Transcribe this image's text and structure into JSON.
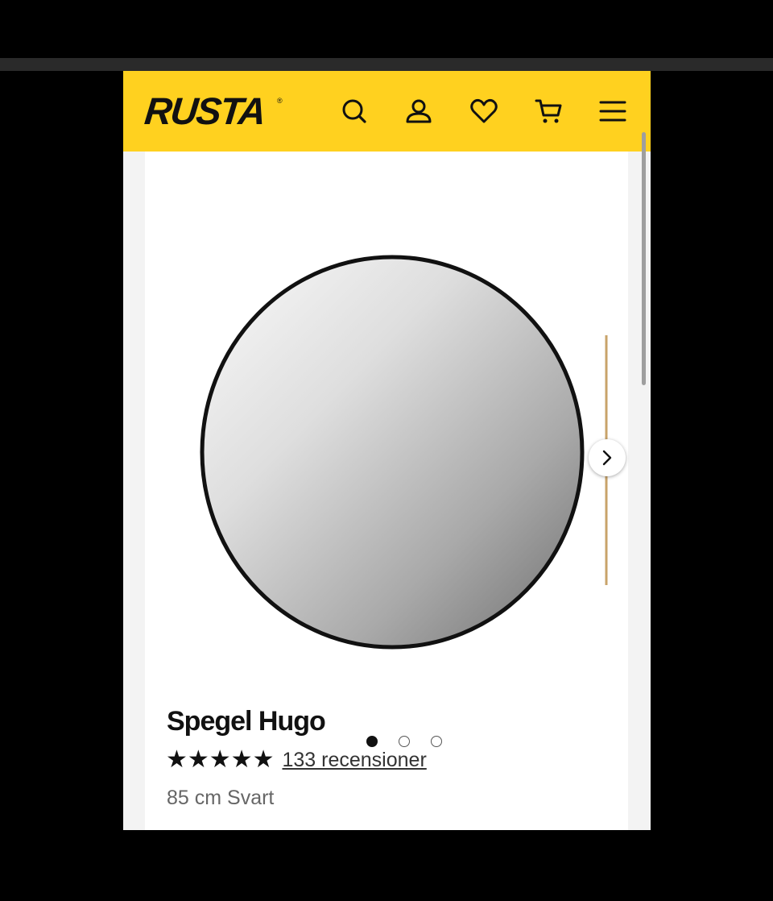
{
  "header": {
    "logo": "RUSTA",
    "background": "#ffd11f",
    "icons": [
      "search-icon",
      "account-icon",
      "heart-icon",
      "cart-icon",
      "menu-icon"
    ]
  },
  "gallery": {
    "next_icon": "chevron-right-icon",
    "dot_count": 3,
    "active_dot": 1
  },
  "product": {
    "title": "Spegel Hugo",
    "rating": 5,
    "rating_stars": "★★★★★",
    "reviews_text": "133 recensioner",
    "variant": "85 cm Svart"
  }
}
